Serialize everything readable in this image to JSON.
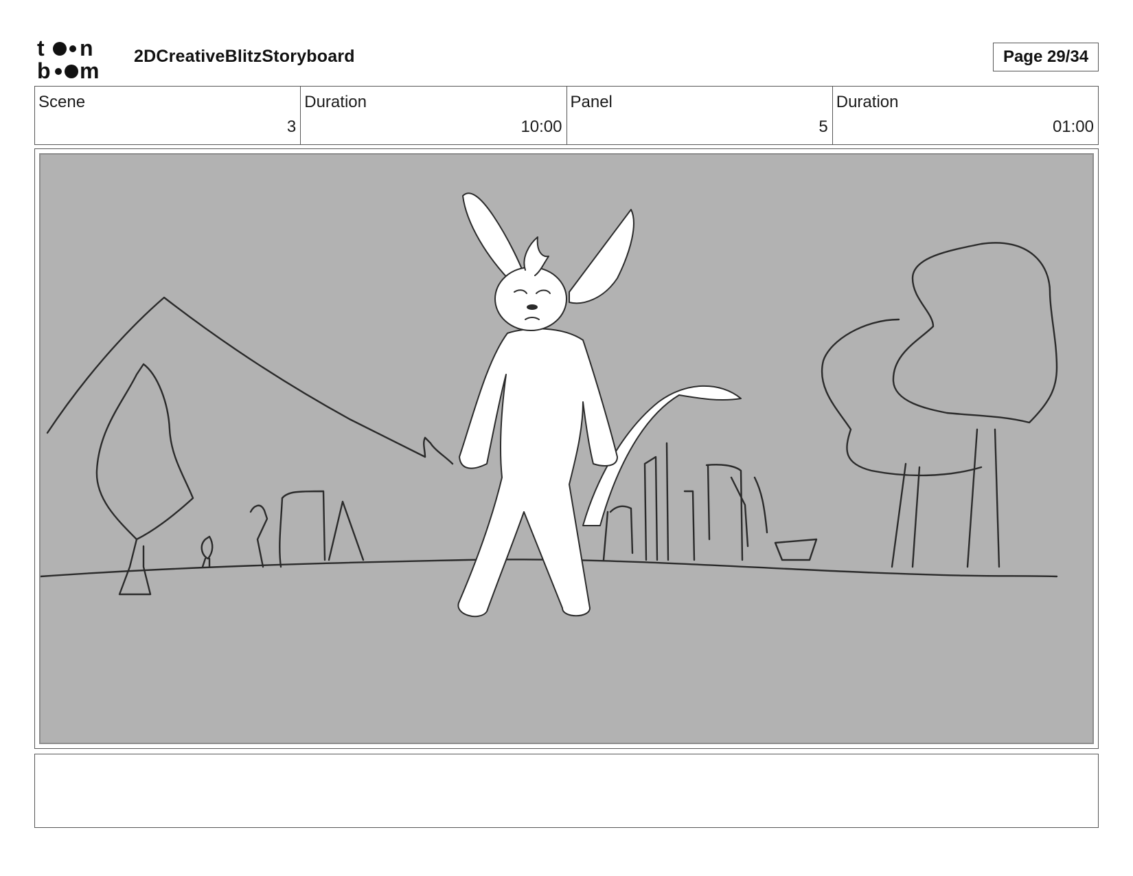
{
  "header": {
    "logo_top": "t●●n",
    "logo_bottom": "b●●m",
    "project_title": "2DCreativeBlitzStoryboard",
    "page_label": "Page 29/34"
  },
  "info": {
    "scene_label": "Scene",
    "scene_value": "3",
    "scene_duration_label": "Duration",
    "scene_duration_value": "10:00",
    "panel_label": "Panel",
    "panel_value": "5",
    "panel_duration_label": "Duration",
    "panel_duration_value": "01:00"
  },
  "panel": {
    "background_color": "#b2b2b2",
    "line_color": "#2a2a2a",
    "character_fill": "#ffffff"
  },
  "notes": {
    "text": ""
  }
}
